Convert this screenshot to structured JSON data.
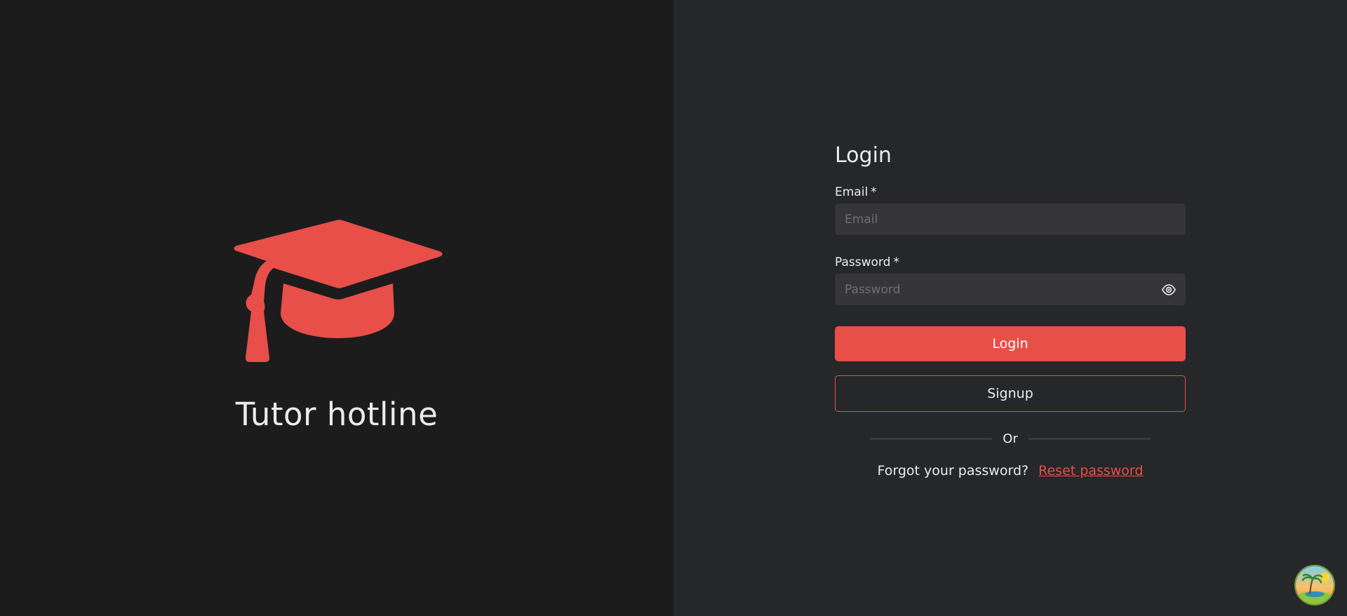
{
  "brand": {
    "title": "Tutor hotline",
    "logo_icon": "graduation-cap-icon",
    "accent_color": "#e84f48"
  },
  "login_form": {
    "title": "Login",
    "email_label": "Email",
    "email_required_mark": "*",
    "email_placeholder": "Email",
    "password_label": "Password",
    "password_required_mark": "*",
    "password_placeholder": "Password",
    "password_toggle_icon": "eye-icon",
    "login_button_label": "Login",
    "signup_button_label": "Signup",
    "divider_text": "Or",
    "forgot_text": "Forgot your password?",
    "reset_link_label": "Reset password"
  },
  "corner_badge": {
    "icon": "tropical-island-avatar-icon"
  }
}
